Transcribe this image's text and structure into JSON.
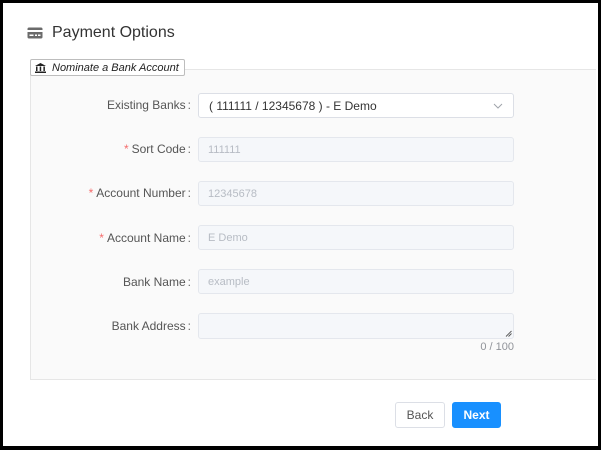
{
  "header": {
    "title": "Payment Options",
    "icon": "credit-card-icon"
  },
  "section": {
    "legend": "Nominate a Bank Account",
    "icon": "bank-icon"
  },
  "form": {
    "existing_banks": {
      "label": "Existing Banks",
      "value": "( 111111 / 12345678 ) - E Demo"
    },
    "sort_code": {
      "label": "Sort Code",
      "placeholder": "111111",
      "required": true
    },
    "account_number": {
      "label": "Account Number",
      "placeholder": "12345678",
      "required": true
    },
    "account_name": {
      "label": "Account Name",
      "placeholder": "E Demo",
      "required": true
    },
    "bank_name": {
      "label": "Bank Name",
      "placeholder": "example"
    },
    "bank_address": {
      "label": "Bank Address",
      "counter": "0 / 100"
    },
    "required_mark": "*",
    "colon": ":"
  },
  "actions": {
    "back_label": "Back",
    "next_label": "Next"
  },
  "colors": {
    "primary": "#1890ff",
    "required": "#f56c6c",
    "panel_bg": "#fafafa"
  }
}
